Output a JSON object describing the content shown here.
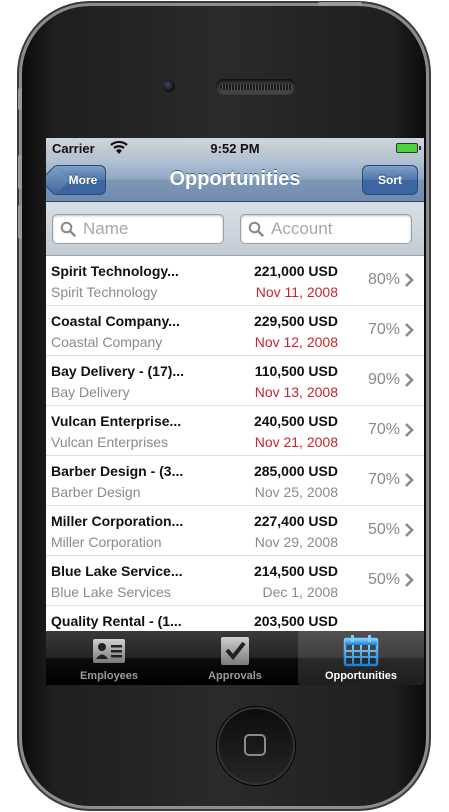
{
  "status": {
    "carrier": "Carrier",
    "time": "9:52 PM"
  },
  "navbar": {
    "back_label": "More",
    "title": "Opportunities",
    "sort_label": "Sort"
  },
  "search": {
    "name_placeholder": "Name",
    "account_placeholder": "Account"
  },
  "rows": [
    {
      "title": "Spirit Technology...",
      "account": "Spirit Technology",
      "amount": "221,000 USD",
      "date": "Nov 11, 2008",
      "date_overdue": true,
      "probability": "80%"
    },
    {
      "title": "Coastal Company...",
      "account": "Coastal Company",
      "amount": "229,500 USD",
      "date": "Nov 12, 2008",
      "date_overdue": true,
      "probability": "70%"
    },
    {
      "title": "Bay Delivery - (17)...",
      "account": "Bay Delivery",
      "amount": "110,500 USD",
      "date": "Nov 13, 2008",
      "date_overdue": true,
      "probability": "90%"
    },
    {
      "title": "Vulcan Enterprise...",
      "account": "Vulcan Enterprises",
      "amount": "240,500 USD",
      "date": "Nov 21, 2008",
      "date_overdue": true,
      "probability": "70%"
    },
    {
      "title": "Barber Design - (3...",
      "account": "Barber Design",
      "amount": "285,000 USD",
      "date": "Nov 25, 2008",
      "date_overdue": false,
      "probability": "70%"
    },
    {
      "title": "Miller Corporation...",
      "account": "Miller Corporation",
      "amount": "227,400 USD",
      "date": "Nov 29, 2008",
      "date_overdue": false,
      "probability": "50%"
    },
    {
      "title": "Blue Lake Service...",
      "account": "Blue Lake Services",
      "amount": "214,500 USD",
      "date": "Dec 1, 2008",
      "date_overdue": false,
      "probability": "50%"
    },
    {
      "title": "Quality Rental - (1...",
      "account": "",
      "amount": "203,500 USD",
      "date": "",
      "date_overdue": false,
      "probability": ""
    }
  ],
  "tabs": [
    {
      "label": "Employees",
      "icon": "contact-card-icon",
      "active": false
    },
    {
      "label": "Approvals",
      "icon": "checkbox-icon",
      "active": false
    },
    {
      "label": "Opportunities",
      "icon": "calendar-icon",
      "active": true
    }
  ],
  "colors": {
    "overdue_date": "#c8242b",
    "nav_blue": "#6f8bae",
    "tab_active_label": "#ffffff"
  }
}
